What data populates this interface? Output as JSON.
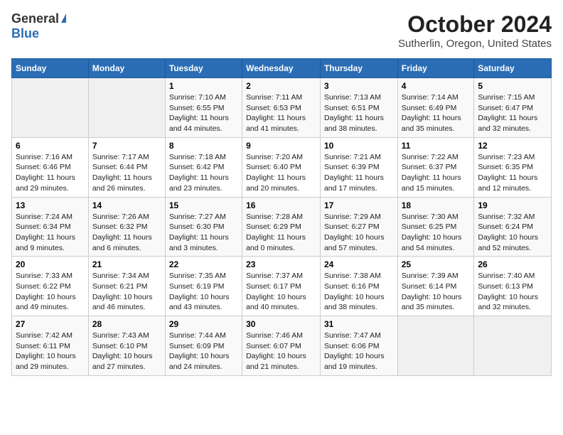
{
  "logo": {
    "general": "General",
    "blue": "Blue"
  },
  "title": "October 2024",
  "subtitle": "Sutherlin, Oregon, United States",
  "days_of_week": [
    "Sunday",
    "Monday",
    "Tuesday",
    "Wednesday",
    "Thursday",
    "Friday",
    "Saturday"
  ],
  "weeks": [
    [
      {
        "day": "",
        "info": ""
      },
      {
        "day": "",
        "info": ""
      },
      {
        "day": "1",
        "info": "Sunrise: 7:10 AM\nSunset: 6:55 PM\nDaylight: 11 hours and 44 minutes."
      },
      {
        "day": "2",
        "info": "Sunrise: 7:11 AM\nSunset: 6:53 PM\nDaylight: 11 hours and 41 minutes."
      },
      {
        "day": "3",
        "info": "Sunrise: 7:13 AM\nSunset: 6:51 PM\nDaylight: 11 hours and 38 minutes."
      },
      {
        "day": "4",
        "info": "Sunrise: 7:14 AM\nSunset: 6:49 PM\nDaylight: 11 hours and 35 minutes."
      },
      {
        "day": "5",
        "info": "Sunrise: 7:15 AM\nSunset: 6:47 PM\nDaylight: 11 hours and 32 minutes."
      }
    ],
    [
      {
        "day": "6",
        "info": "Sunrise: 7:16 AM\nSunset: 6:46 PM\nDaylight: 11 hours and 29 minutes."
      },
      {
        "day": "7",
        "info": "Sunrise: 7:17 AM\nSunset: 6:44 PM\nDaylight: 11 hours and 26 minutes."
      },
      {
        "day": "8",
        "info": "Sunrise: 7:18 AM\nSunset: 6:42 PM\nDaylight: 11 hours and 23 minutes."
      },
      {
        "day": "9",
        "info": "Sunrise: 7:20 AM\nSunset: 6:40 PM\nDaylight: 11 hours and 20 minutes."
      },
      {
        "day": "10",
        "info": "Sunrise: 7:21 AM\nSunset: 6:39 PM\nDaylight: 11 hours and 17 minutes."
      },
      {
        "day": "11",
        "info": "Sunrise: 7:22 AM\nSunset: 6:37 PM\nDaylight: 11 hours and 15 minutes."
      },
      {
        "day": "12",
        "info": "Sunrise: 7:23 AM\nSunset: 6:35 PM\nDaylight: 11 hours and 12 minutes."
      }
    ],
    [
      {
        "day": "13",
        "info": "Sunrise: 7:24 AM\nSunset: 6:34 PM\nDaylight: 11 hours and 9 minutes."
      },
      {
        "day": "14",
        "info": "Sunrise: 7:26 AM\nSunset: 6:32 PM\nDaylight: 11 hours and 6 minutes."
      },
      {
        "day": "15",
        "info": "Sunrise: 7:27 AM\nSunset: 6:30 PM\nDaylight: 11 hours and 3 minutes."
      },
      {
        "day": "16",
        "info": "Sunrise: 7:28 AM\nSunset: 6:29 PM\nDaylight: 11 hours and 0 minutes."
      },
      {
        "day": "17",
        "info": "Sunrise: 7:29 AM\nSunset: 6:27 PM\nDaylight: 10 hours and 57 minutes."
      },
      {
        "day": "18",
        "info": "Sunrise: 7:30 AM\nSunset: 6:25 PM\nDaylight: 10 hours and 54 minutes."
      },
      {
        "day": "19",
        "info": "Sunrise: 7:32 AM\nSunset: 6:24 PM\nDaylight: 10 hours and 52 minutes."
      }
    ],
    [
      {
        "day": "20",
        "info": "Sunrise: 7:33 AM\nSunset: 6:22 PM\nDaylight: 10 hours and 49 minutes."
      },
      {
        "day": "21",
        "info": "Sunrise: 7:34 AM\nSunset: 6:21 PM\nDaylight: 10 hours and 46 minutes."
      },
      {
        "day": "22",
        "info": "Sunrise: 7:35 AM\nSunset: 6:19 PM\nDaylight: 10 hours and 43 minutes."
      },
      {
        "day": "23",
        "info": "Sunrise: 7:37 AM\nSunset: 6:17 PM\nDaylight: 10 hours and 40 minutes."
      },
      {
        "day": "24",
        "info": "Sunrise: 7:38 AM\nSunset: 6:16 PM\nDaylight: 10 hours and 38 minutes."
      },
      {
        "day": "25",
        "info": "Sunrise: 7:39 AM\nSunset: 6:14 PM\nDaylight: 10 hours and 35 minutes."
      },
      {
        "day": "26",
        "info": "Sunrise: 7:40 AM\nSunset: 6:13 PM\nDaylight: 10 hours and 32 minutes."
      }
    ],
    [
      {
        "day": "27",
        "info": "Sunrise: 7:42 AM\nSunset: 6:11 PM\nDaylight: 10 hours and 29 minutes."
      },
      {
        "day": "28",
        "info": "Sunrise: 7:43 AM\nSunset: 6:10 PM\nDaylight: 10 hours and 27 minutes."
      },
      {
        "day": "29",
        "info": "Sunrise: 7:44 AM\nSunset: 6:09 PM\nDaylight: 10 hours and 24 minutes."
      },
      {
        "day": "30",
        "info": "Sunrise: 7:46 AM\nSunset: 6:07 PM\nDaylight: 10 hours and 21 minutes."
      },
      {
        "day": "31",
        "info": "Sunrise: 7:47 AM\nSunset: 6:06 PM\nDaylight: 10 hours and 19 minutes."
      },
      {
        "day": "",
        "info": ""
      },
      {
        "day": "",
        "info": ""
      }
    ]
  ]
}
